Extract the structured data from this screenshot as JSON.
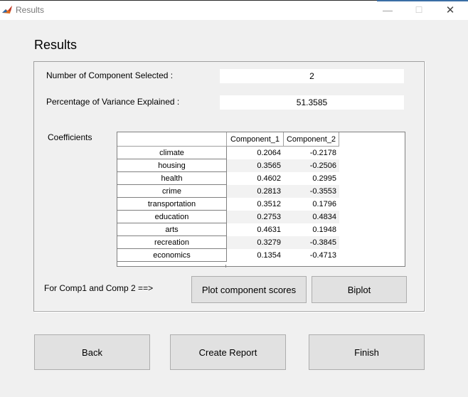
{
  "window": {
    "title": "Results",
    "minimize": "—",
    "maximize": "☐",
    "close": "✕"
  },
  "heading": "Results",
  "num_components": {
    "label": "Number of Component Selected :",
    "value": "2"
  },
  "variance": {
    "label": "Percentage of Variance Explained :",
    "value": "51.3585"
  },
  "coefficients": {
    "label": "Coefficients",
    "columns": [
      "Component_1",
      "Component_2"
    ],
    "rows": [
      {
        "name": "climate",
        "c1": "0.2064",
        "c2": "-0.2178"
      },
      {
        "name": "housing",
        "c1": "0.3565",
        "c2": "-0.2506"
      },
      {
        "name": "health",
        "c1": "0.4602",
        "c2": "0.2995"
      },
      {
        "name": "crime",
        "c1": "0.2813",
        "c2": "-0.3553"
      },
      {
        "name": "transportation",
        "c1": "0.3512",
        "c2": "0.1796"
      },
      {
        "name": "education",
        "c1": "0.2753",
        "c2": "0.4834"
      },
      {
        "name": "arts",
        "c1": "0.4631",
        "c2": "0.1948"
      },
      {
        "name": "recreation",
        "c1": "0.3279",
        "c2": "-0.3845"
      },
      {
        "name": "economics",
        "c1": "0.1354",
        "c2": "-0.4713"
      }
    ]
  },
  "plot_prompt": "For Comp1 and Comp 2 ==>",
  "buttons": {
    "plot_scores": "Plot component scores",
    "biplot": "Biplot",
    "back": "Back",
    "create_report": "Create Report",
    "finish": "Finish"
  },
  "colors": {
    "window_bg": "#f0f0f0",
    "button_bg": "#e1e1e1",
    "border": "#adadad"
  }
}
